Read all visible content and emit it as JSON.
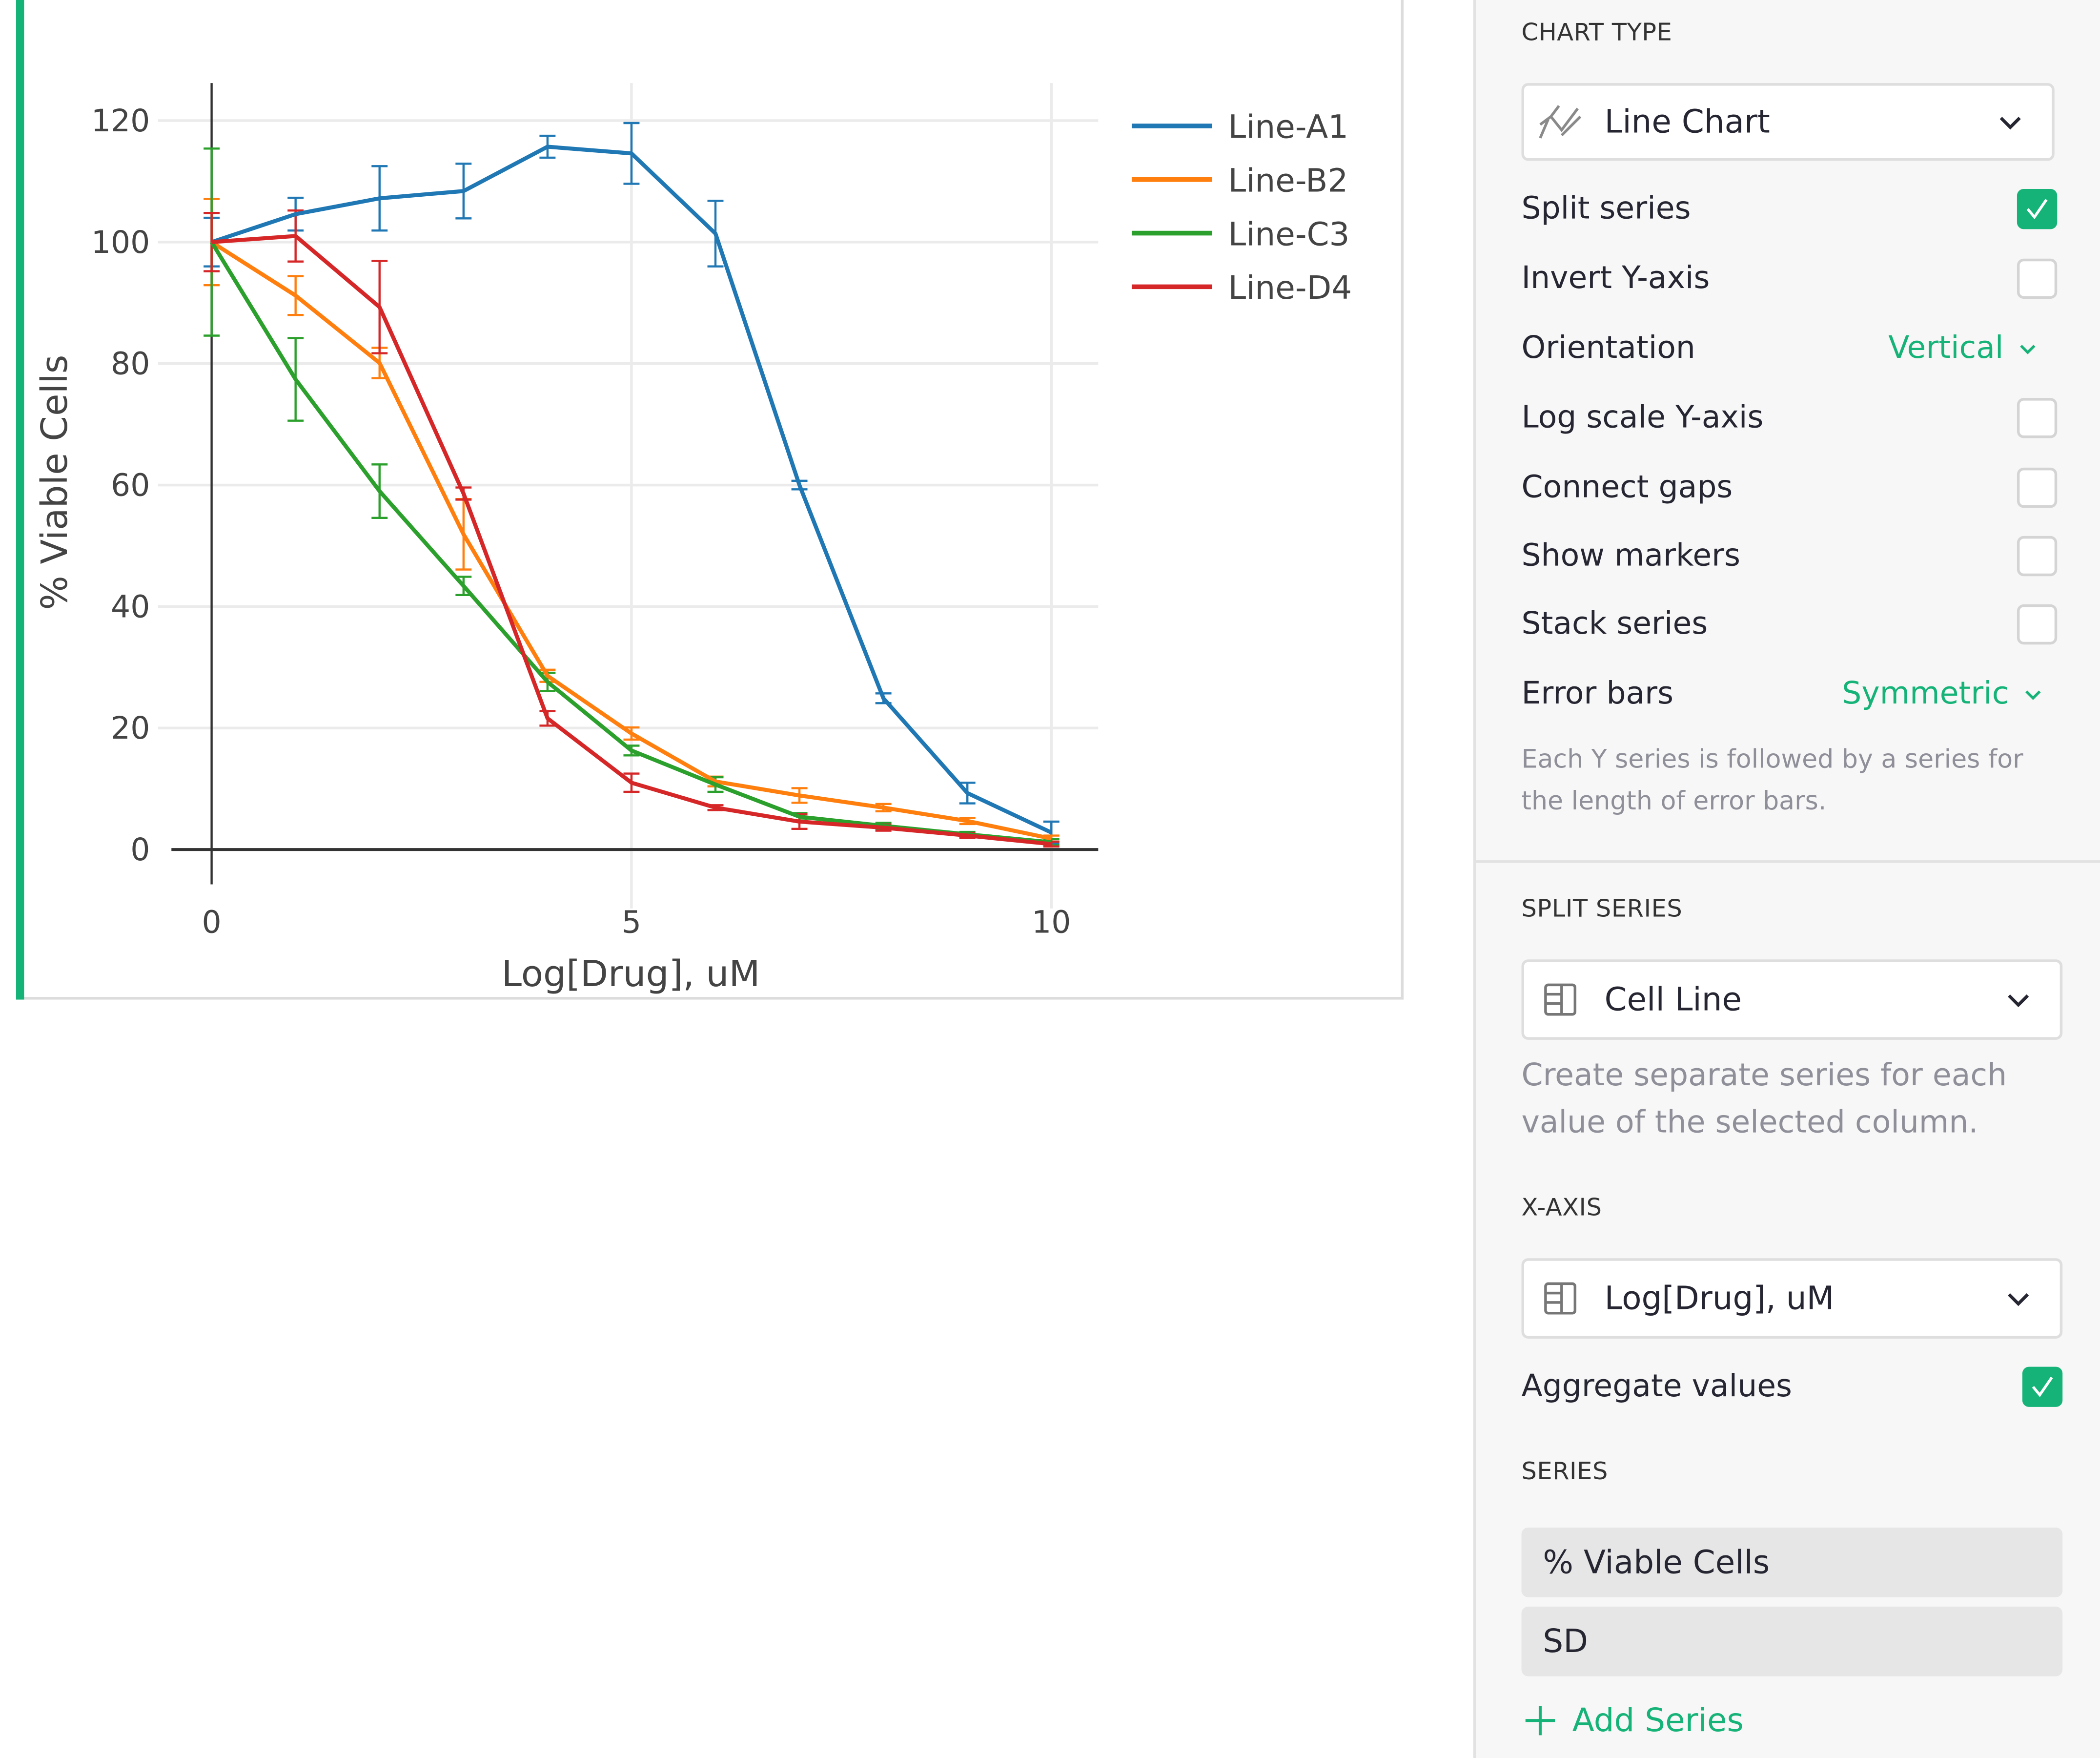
{
  "chart_data": {
    "type": "line",
    "title": "",
    "xlabel": "Log[Drug], uM",
    "ylabel": "% Viable Cells",
    "xlim": [
      0,
      10
    ],
    "ylim": [
      0,
      120
    ],
    "x_ticks": [
      0,
      5,
      10
    ],
    "y_ticks": [
      0,
      20,
      40,
      60,
      80,
      100,
      120
    ],
    "grid": true,
    "legend_position": "top-right",
    "error_bars": "symmetric",
    "x": [
      0,
      1,
      2,
      3,
      4,
      5,
      6,
      7,
      8,
      9,
      10
    ],
    "series": [
      {
        "name": "Line-A1",
        "color": "#1f77b4",
        "values": [
          100,
          104.6,
          107.2,
          108.4,
          115.7,
          114.6,
          101.4,
          60.0,
          24.9,
          9.3,
          2.8
        ],
        "errors": [
          4.0,
          2.7,
          5.3,
          4.5,
          1.8,
          5.0,
          5.4,
          0.7,
          0.8,
          1.7,
          1.8
        ]
      },
      {
        "name": "Line-B2",
        "color": "#ff7f0e",
        "values": [
          100,
          91.2,
          80.1,
          51.9,
          28.6,
          19.1,
          11.2,
          8.9,
          6.9,
          4.7,
          1.8
        ],
        "errors": [
          7.1,
          3.2,
          2.5,
          5.8,
          1.0,
          1.0,
          0.8,
          1.2,
          0.6,
          0.5,
          0.5
        ]
      },
      {
        "name": "Line-C3",
        "color": "#2ca02c",
        "values": [
          100,
          77.4,
          59.0,
          43.4,
          27.6,
          16.3,
          10.7,
          5.4,
          3.9,
          2.5,
          1.2
        ],
        "errors": [
          15.4,
          6.8,
          4.4,
          1.5,
          1.5,
          0.8,
          1.2,
          0.6,
          0.5,
          0.4,
          0.5
        ]
      },
      {
        "name": "Line-D4",
        "color": "#d62728",
        "values": [
          100,
          101.0,
          89.3,
          58.6,
          21.6,
          11.0,
          6.9,
          4.6,
          3.6,
          2.3,
          0.9
        ],
        "errors": [
          4.8,
          4.2,
          7.6,
          1.0,
          1.2,
          1.5,
          0.4,
          1.2,
          0.5,
          0.4,
          0.4
        ]
      }
    ]
  },
  "panel": {
    "chart_type": {
      "title": "CHART TYPE",
      "selected": "Line Chart",
      "icon": "line-chart-icon"
    },
    "options": [
      {
        "label": "Split series",
        "type": "checkbox",
        "checked": true
      },
      {
        "label": "Invert Y-axis",
        "type": "checkbox",
        "checked": false
      },
      {
        "label": "Orientation",
        "type": "select",
        "value": "Vertical"
      },
      {
        "label": "Log scale Y-axis",
        "type": "checkbox",
        "checked": false
      },
      {
        "label": "Connect gaps",
        "type": "checkbox",
        "checked": false
      },
      {
        "label": "Show markers",
        "type": "checkbox",
        "checked": false
      },
      {
        "label": "Stack series",
        "type": "checkbox",
        "checked": false
      },
      {
        "label": "Error bars",
        "type": "select",
        "value": "Symmetric"
      }
    ],
    "error_bars_hint": "Each Y series is followed by a series for the length of error bars.",
    "split_series": {
      "title": "SPLIT SERIES",
      "selected": "Cell Line",
      "icon": "column-icon",
      "hint": "Create separate series for each value of the selected column."
    },
    "x_axis": {
      "title": "X-AXIS",
      "selected": "Log[Drug], uM",
      "icon": "column-icon"
    },
    "aggregate": {
      "label": "Aggregate values",
      "checked": true
    },
    "series": {
      "title": "SERIES",
      "items": [
        "% Viable Cells",
        "SD"
      ],
      "add_label": "Add Series"
    },
    "accent_color": "#16b378"
  }
}
